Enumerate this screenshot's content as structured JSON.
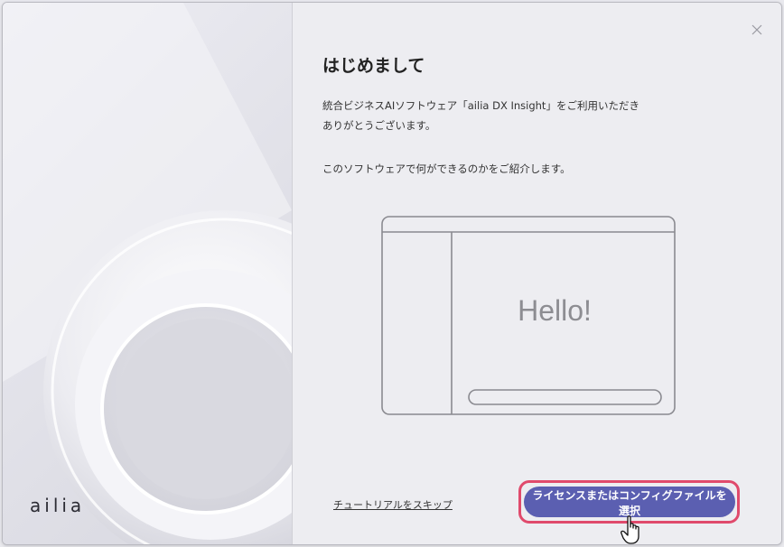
{
  "branding": {
    "logo_text": "ailia"
  },
  "dialog": {
    "title": "はじめまして",
    "description_line1": "統合ビジネスAIソフトウェア「ailia DX Insight」をご利用いただき",
    "description_line2": "ありがとうございます。",
    "description_line3": "このソフトウェアで何ができるのかをご紹介します。",
    "illustration_text": "Hello!",
    "skip_link": "チュートリアルをスキップ",
    "primary_button": "ライセンスまたはコンフィグファイルを選択"
  },
  "icons": {
    "close": "close-icon",
    "cursor": "hand-pointer-icon"
  },
  "colors": {
    "primary": "#5b5fb1",
    "highlight": "#e04a6c",
    "panel_background": "#ededf1"
  }
}
